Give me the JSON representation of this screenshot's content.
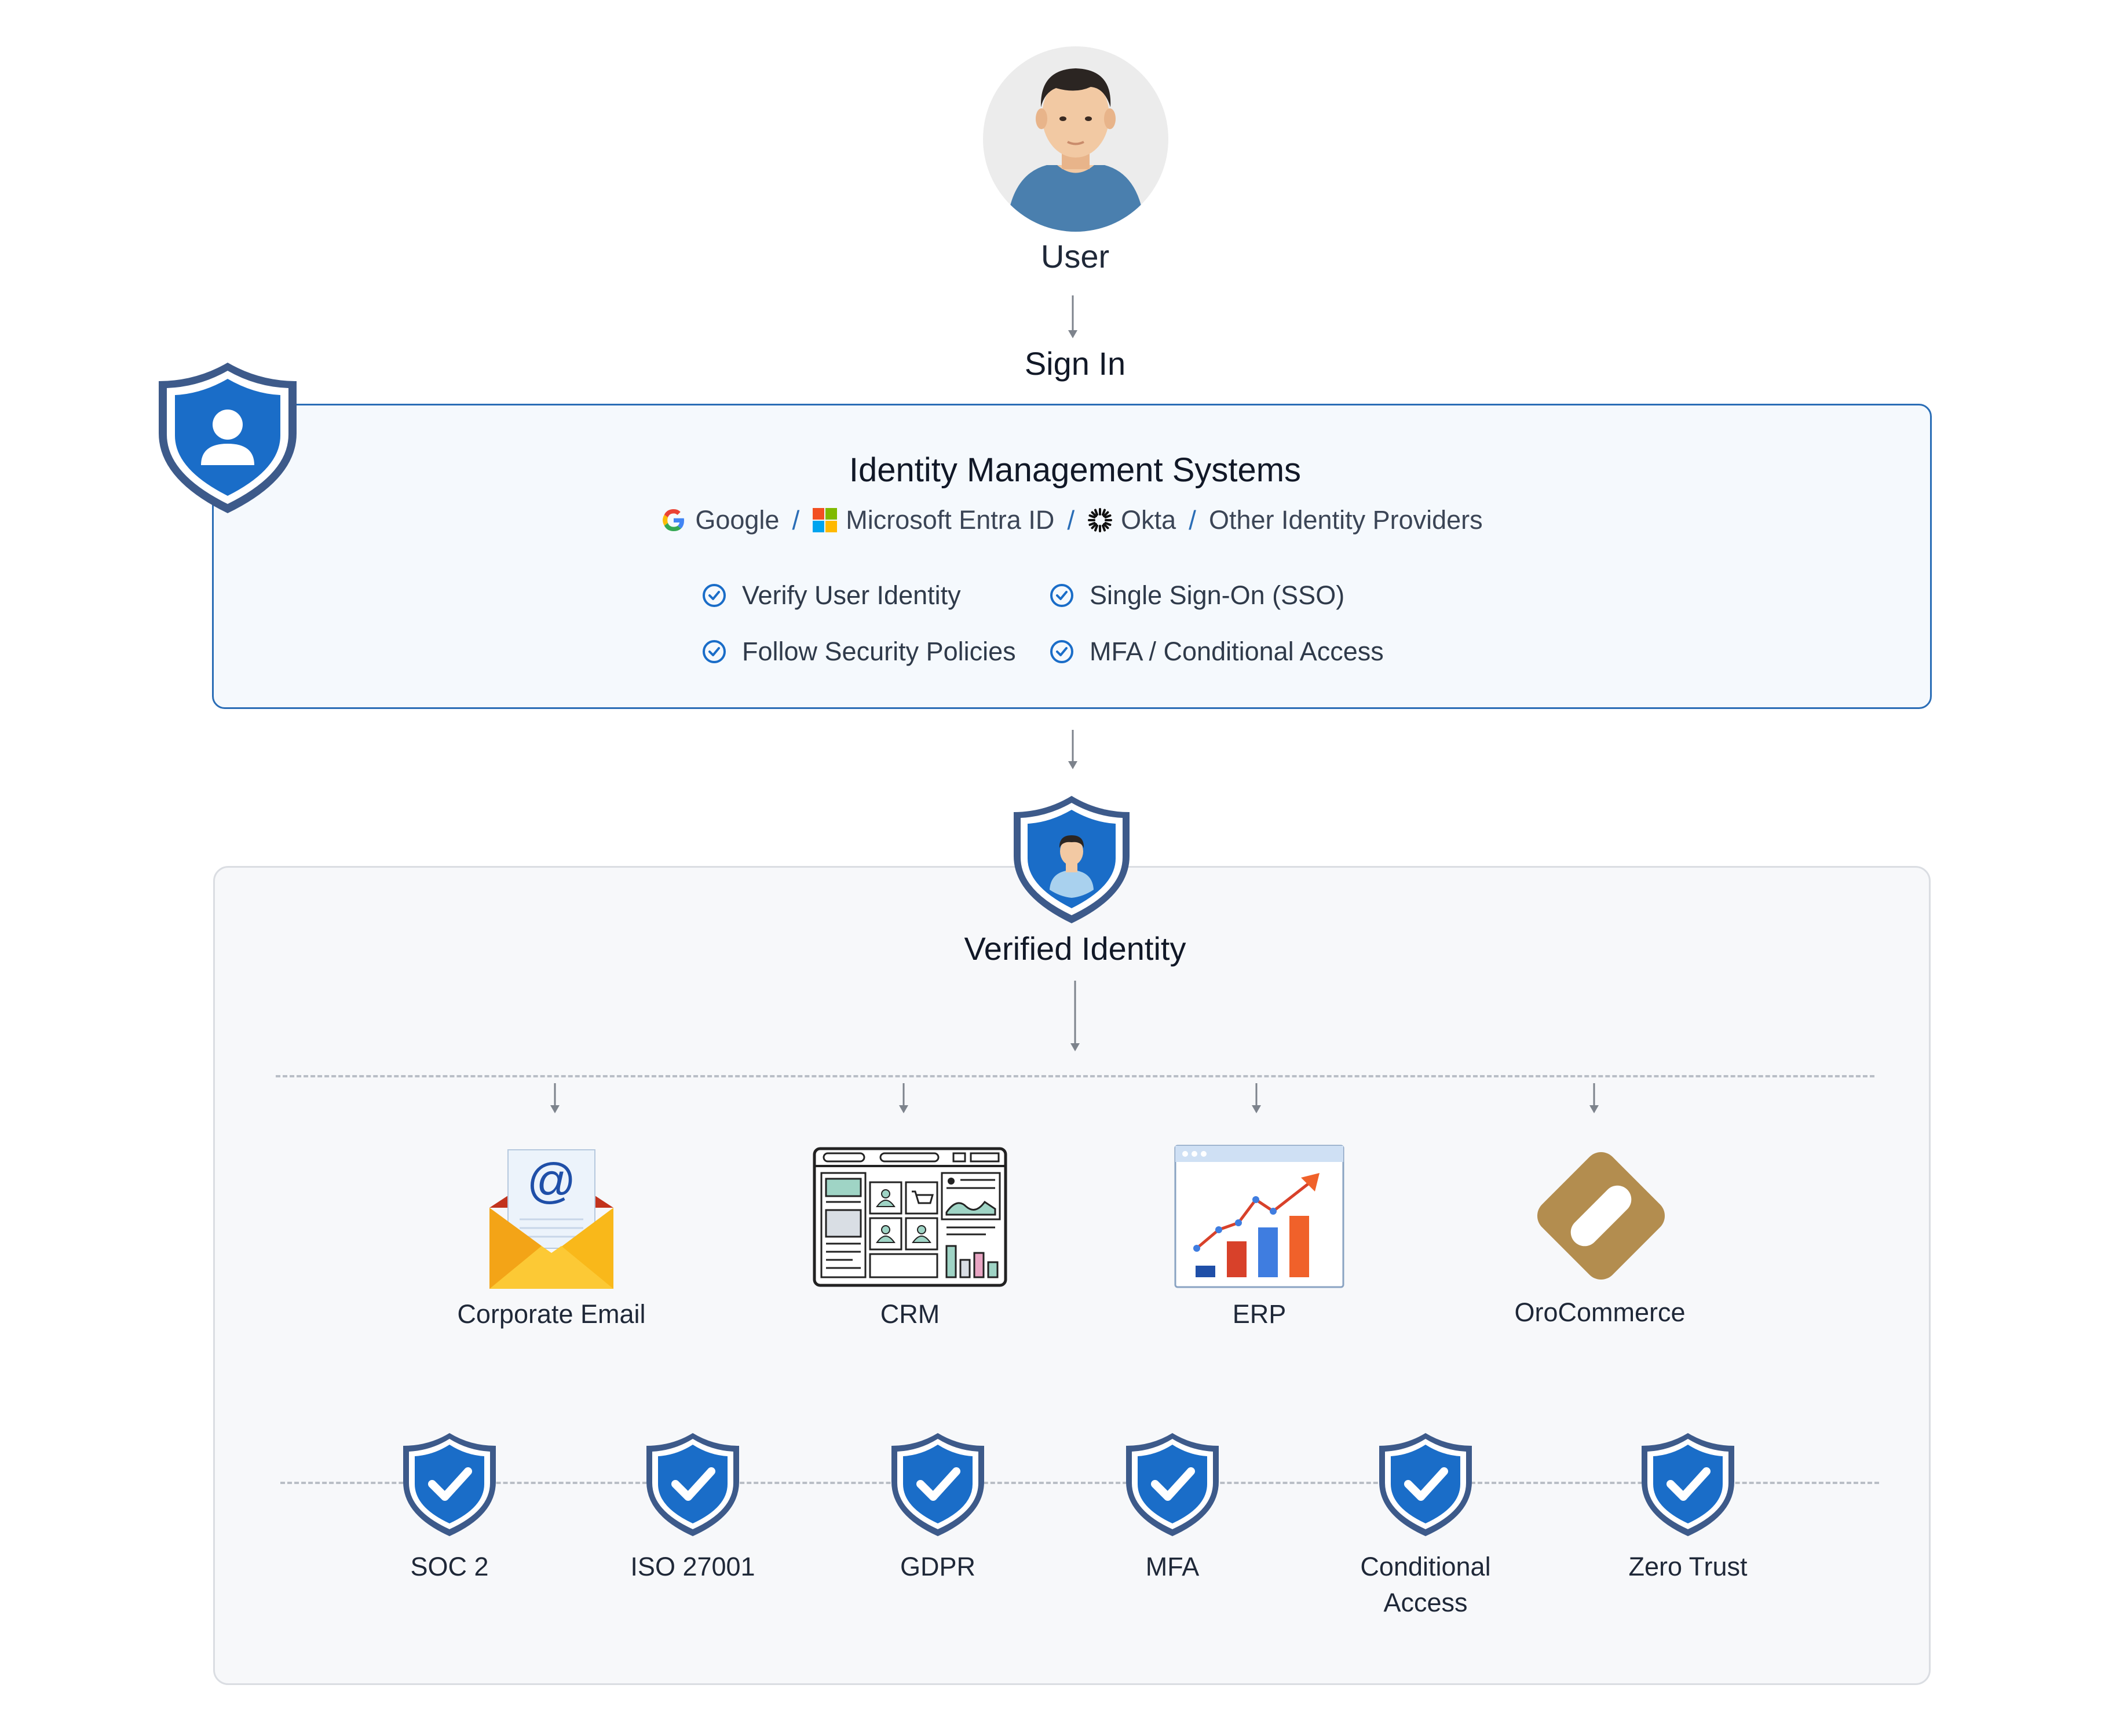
{
  "user": {
    "label": "User"
  },
  "sign_in": {
    "label": "Sign In"
  },
  "identity_management": {
    "title": "Identity Management Systems",
    "providers": [
      {
        "name": "Google",
        "icon": "google-icon"
      },
      {
        "name": "Microsoft Entra ID",
        "icon": "microsoft-icon"
      },
      {
        "name": "Okta",
        "icon": "okta-icon"
      },
      {
        "name": "Other Identity Providers",
        "icon": ""
      }
    ],
    "separator": "/",
    "features": [
      "Verify User Identity",
      "Single Sign-On (SSO)",
      "Follow Security Policies",
      "MFA / Conditional Access"
    ]
  },
  "verified": {
    "label": "Verified Identity"
  },
  "apps": [
    {
      "label": "Corporate Email",
      "icon": "email-icon"
    },
    {
      "label": "CRM",
      "icon": "crm-dashboard-icon"
    },
    {
      "label": "ERP",
      "icon": "erp-chart-icon"
    },
    {
      "label": "OroCommerce",
      "icon": "orocommerce-logo-icon"
    }
  ],
  "compliance": [
    {
      "label": "SOC 2"
    },
    {
      "label": "ISO 27001"
    },
    {
      "label": "GDPR"
    },
    {
      "label": "MFA"
    },
    {
      "label": "Conditional\nAccess"
    },
    {
      "label": "Zero Trust"
    }
  ],
  "colors": {
    "primary_blue": "#1a6dc8",
    "shield_border": "#3b5a8f",
    "panel_border": "#2a6db6",
    "panel_bg": "#f5f9fd",
    "accent_orange": "#f0612a",
    "oro_brown": "#b38d4f"
  }
}
